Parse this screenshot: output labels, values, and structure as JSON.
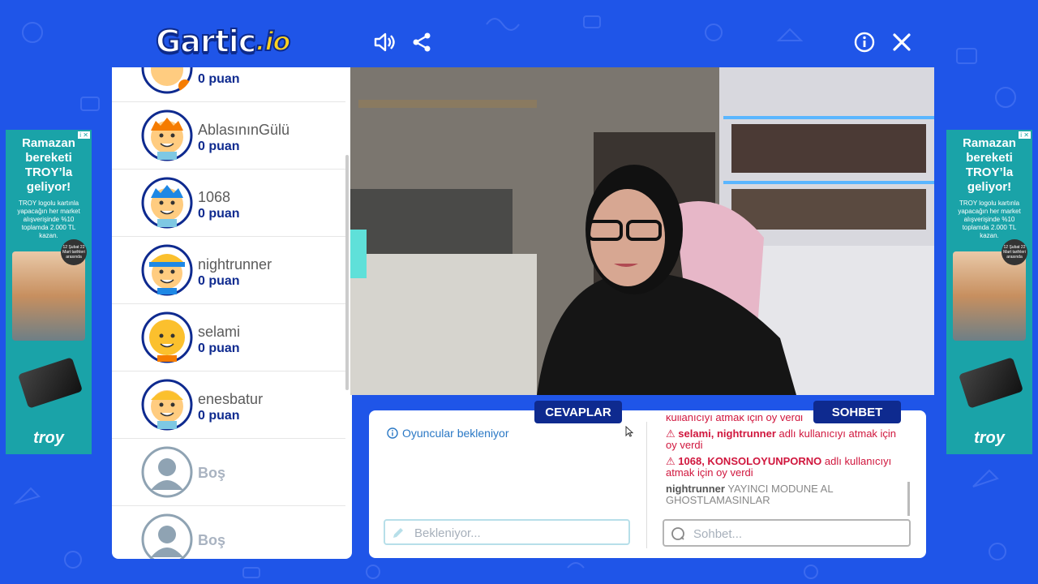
{
  "header": {
    "logo_main": "Gartic",
    "logo_suffix": ".io"
  },
  "players": [
    {
      "name": "",
      "points": "0 puan",
      "avatar_color": "#1e88e5"
    },
    {
      "name": "AblasınınGülü",
      "points": "0 puan",
      "avatar_color": "#f57c00"
    },
    {
      "name": "1068",
      "points": "0 puan",
      "avatar_color": "#1e88e5"
    },
    {
      "name": "nightrunner",
      "points": "0 puan",
      "avatar_color": "#1e88e5"
    },
    {
      "name": "selami",
      "points": "0 puan",
      "avatar_color": "#fbc02d"
    },
    {
      "name": "enesbatur",
      "points": "0 puan",
      "avatar_color": "#f57c00"
    },
    {
      "name": "Boş",
      "points": "",
      "avatar_color": "#8fa3b3"
    },
    {
      "name": "Boş",
      "points": "",
      "avatar_color": "#8fa3b3"
    }
  ],
  "answers": {
    "tab_label": "CEVAPLAR",
    "status": "Oyuncular bekleniyor",
    "placeholder": "Bekleniyor..."
  },
  "chat": {
    "tab_label": "SOHBET",
    "placeholder": "Sohbet...",
    "messages": [
      {
        "type": "warn",
        "names": "",
        "text": "kullanıcıyı atmak için oy verdi"
      },
      {
        "type": "warn",
        "names": "selami, nightrunner",
        "text": " adlı kullanıcıyı atmak için oy verdi"
      },
      {
        "type": "warn",
        "names": "1068, KONSOLOYUNPORNO",
        "text": " adlı kullanıcıyı atmak için oy verdi"
      },
      {
        "type": "chat",
        "names": "nightrunner",
        "text": " YAYINCI MODUNE AL GHOSTLAMASINLAR"
      }
    ]
  },
  "ads": {
    "headline": "Ramazan bereketi TROY’la geliyor!",
    "body": "TROY logolu kartınla yapacağın her market alışverişinde %10 toplamda 2.000 TL kazan.",
    "badge": "12 Şubat 22 Mart tarihleri arasında",
    "brand": "troy",
    "choice": "i ✕"
  },
  "colors": {
    "background": "#1f55e8",
    "navy": "#0e2a8f",
    "warn": "#d0163d",
    "ad": "#1aa3a8"
  }
}
